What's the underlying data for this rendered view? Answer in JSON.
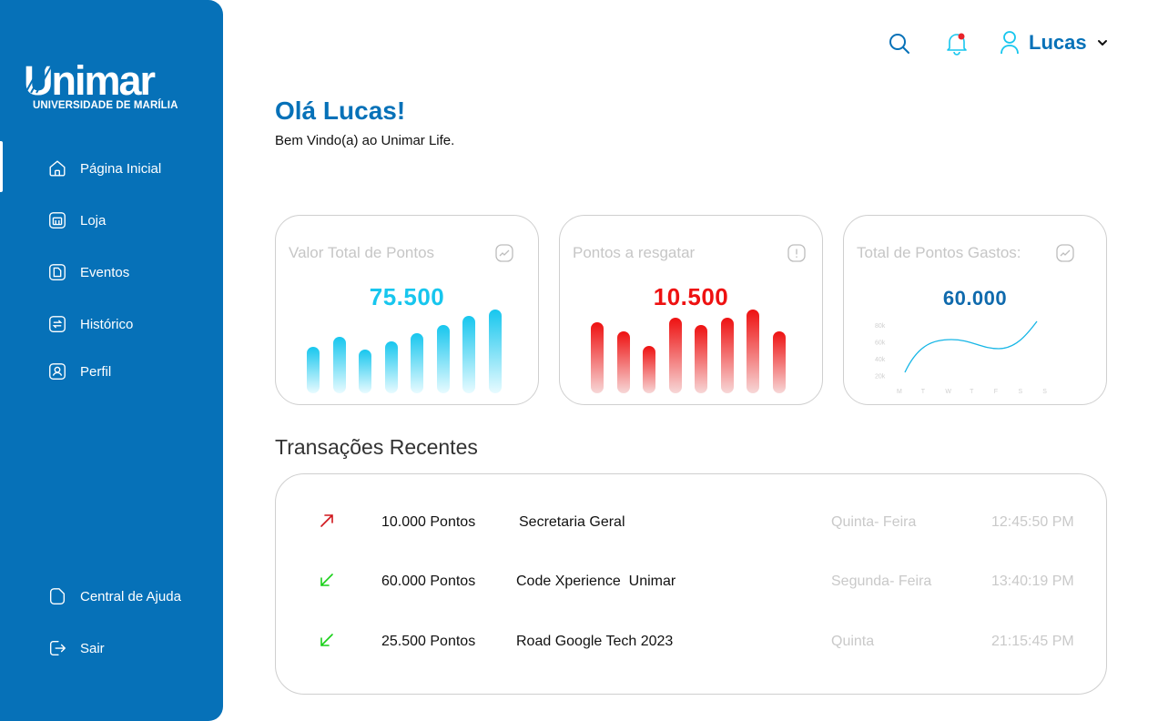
{
  "sidebar": {
    "logo_text": "Unimar",
    "logo_subtitle": "UNIVERSIDADE DE MARÍLIA",
    "items": [
      {
        "label": "Página Inicial",
        "icon": "home-icon",
        "active": true
      },
      {
        "label": "Loja",
        "icon": "store-icon"
      },
      {
        "label": "Eventos",
        "icon": "document-icon"
      },
      {
        "label": "Histórico",
        "icon": "history-icon"
      },
      {
        "label": "Perfil",
        "icon": "profile-icon"
      }
    ],
    "bottom_items": [
      {
        "label": "Central de Ajuda",
        "icon": "help-icon"
      },
      {
        "label": "Sair",
        "icon": "logout-icon"
      }
    ]
  },
  "header": {
    "user_name": "Lucas",
    "notification_dot_color": "#e8232a"
  },
  "greeting": {
    "title": "Olá Lucas!",
    "subtitle": "Bem Vindo(a) ao Unimar Life."
  },
  "cards": [
    {
      "title": "Valor Total de Pontos",
      "value": "75.500",
      "value_color": "#17c6ee",
      "bar_levels": [
        0.55,
        0.67,
        0.52,
        0.62,
        0.72,
        0.82,
        0.92,
        1.0
      ]
    },
    {
      "title": "Pontos a resgatar",
      "value": "10.500",
      "value_color": "#ee1111",
      "bar_levels": [
        0.85,
        0.74,
        0.57,
        0.9,
        0.81,
        0.9,
        1.0,
        0.74
      ]
    },
    {
      "title": "Total de Pontos Gastos:",
      "value": "60.000",
      "value_color": "#0f6aad",
      "mini_chart": {
        "y_ticks": [
          "80k",
          "60k",
          "40k",
          "20k"
        ],
        "x_ticks": [
          "M",
          "T",
          "W",
          "T",
          "F",
          "S",
          "S"
        ]
      }
    }
  ],
  "colors": {
    "brand": "#0671b8",
    "up_arrow": "#d0161c",
    "down_arrow": "#19d019"
  },
  "transactions": {
    "title": "Transações Recentes",
    "rows": [
      {
        "direction": "up",
        "points": "10.000 Pontos",
        "description": "Secretaria Geral",
        "day": "Quinta- Feira",
        "time": "12:45:50 PM"
      },
      {
        "direction": "down",
        "points": "60.000 Pontos",
        "description": "Code Xperience  Unimar",
        "day": "Segunda- Feira",
        "time": "13:40:19 PM"
      },
      {
        "direction": "down",
        "points": "25.500 Pontos",
        "description": "Road Google Tech 2023",
        "day": "Quinta",
        "time": "21:15:45 PM"
      }
    ]
  }
}
